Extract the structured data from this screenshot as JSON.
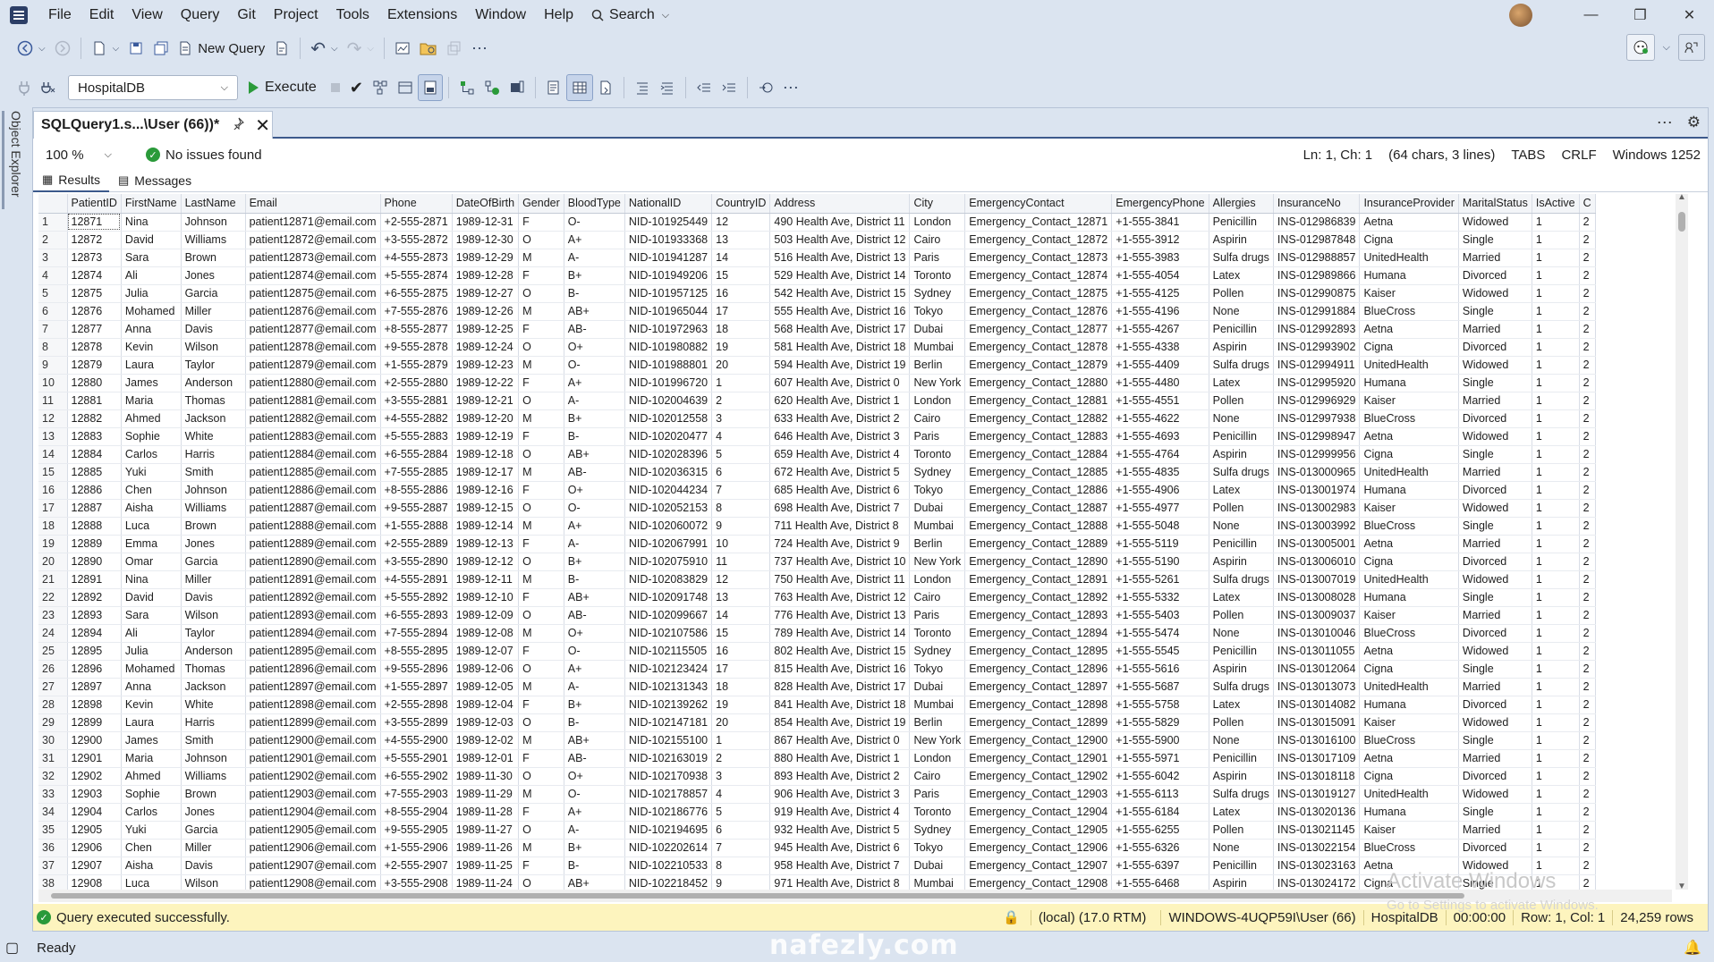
{
  "menu": [
    "File",
    "Edit",
    "View",
    "Query",
    "Git",
    "Project",
    "Tools",
    "Extensions",
    "Window",
    "Help"
  ],
  "search_label": "Search",
  "toolbar": {
    "new_query": "New Query",
    "execute": "Execute",
    "database": "HospitalDB"
  },
  "sidebar": {
    "object_explorer": "Object Explorer"
  },
  "tab": {
    "title": "SQLQuery1.s...\\User (66))*"
  },
  "editor": {
    "zoom": "100 %",
    "issues": "No issues found",
    "ln": "Ln: 1, Ch: 1",
    "chars": "(64 chars, 3 lines)",
    "tabs": "TABS",
    "crlf": "CRLF",
    "encoding": "Windows 1252"
  },
  "result_tabs": {
    "results": "Results",
    "messages": "Messages"
  },
  "grid": {
    "columns": [
      "PatientID",
      "FirstName",
      "LastName",
      "Email",
      "Phone",
      "DateOfBirth",
      "Gender",
      "BloodType",
      "NationalID",
      "CountryID",
      "Address",
      "City",
      "EmergencyContact",
      "EmergencyPhone",
      "Allergies",
      "InsuranceNo",
      "InsuranceProvider",
      "MaritalStatus",
      "IsActive",
      "C"
    ],
    "rows": [
      [
        "1",
        "12871",
        "Nina",
        "Johnson",
        "patient12871@email.com",
        "+2-555-2871",
        "1989-12-31",
        "F",
        "O-",
        "NID-101925449",
        "12",
        "490 Health Ave, District 11",
        "London",
        "Emergency_Contact_12871",
        "+1-555-3841",
        "Penicillin",
        "INS-012986839",
        "Aetna",
        "Widowed",
        "1",
        "2"
      ],
      [
        "2",
        "12872",
        "David",
        "Williams",
        "patient12872@email.com",
        "+3-555-2872",
        "1989-12-30",
        "O",
        "A+",
        "NID-101933368",
        "13",
        "503 Health Ave, District 12",
        "Cairo",
        "Emergency_Contact_12872",
        "+1-555-3912",
        "Aspirin",
        "INS-012987848",
        "Cigna",
        "Single",
        "1",
        "2"
      ],
      [
        "3",
        "12873",
        "Sara",
        "Brown",
        "patient12873@email.com",
        "+4-555-2873",
        "1989-12-29",
        "M",
        "A-",
        "NID-101941287",
        "14",
        "516 Health Ave, District 13",
        "Paris",
        "Emergency_Contact_12873",
        "+1-555-3983",
        "Sulfa drugs",
        "INS-012988857",
        "UnitedHealth",
        "Married",
        "1",
        "2"
      ],
      [
        "4",
        "12874",
        "Ali",
        "Jones",
        "patient12874@email.com",
        "+5-555-2874",
        "1989-12-28",
        "F",
        "B+",
        "NID-101949206",
        "15",
        "529 Health Ave, District 14",
        "Toronto",
        "Emergency_Contact_12874",
        "+1-555-4054",
        "Latex",
        "INS-012989866",
        "Humana",
        "Divorced",
        "1",
        "2"
      ],
      [
        "5",
        "12875",
        "Julia",
        "Garcia",
        "patient12875@email.com",
        "+6-555-2875",
        "1989-12-27",
        "O",
        "B-",
        "NID-101957125",
        "16",
        "542 Health Ave, District 15",
        "Sydney",
        "Emergency_Contact_12875",
        "+1-555-4125",
        "Pollen",
        "INS-012990875",
        "Kaiser",
        "Widowed",
        "1",
        "2"
      ],
      [
        "6",
        "12876",
        "Mohamed",
        "Miller",
        "patient12876@email.com",
        "+7-555-2876",
        "1989-12-26",
        "M",
        "AB+",
        "NID-101965044",
        "17",
        "555 Health Ave, District 16",
        "Tokyo",
        "Emergency_Contact_12876",
        "+1-555-4196",
        "None",
        "INS-012991884",
        "BlueCross",
        "Single",
        "1",
        "2"
      ],
      [
        "7",
        "12877",
        "Anna",
        "Davis",
        "patient12877@email.com",
        "+8-555-2877",
        "1989-12-25",
        "F",
        "AB-",
        "NID-101972963",
        "18",
        "568 Health Ave, District 17",
        "Dubai",
        "Emergency_Contact_12877",
        "+1-555-4267",
        "Penicillin",
        "INS-012992893",
        "Aetna",
        "Married",
        "1",
        "2"
      ],
      [
        "8",
        "12878",
        "Kevin",
        "Wilson",
        "patient12878@email.com",
        "+9-555-2878",
        "1989-12-24",
        "O",
        "O+",
        "NID-101980882",
        "19",
        "581 Health Ave, District 18",
        "Mumbai",
        "Emergency_Contact_12878",
        "+1-555-4338",
        "Aspirin",
        "INS-012993902",
        "Cigna",
        "Divorced",
        "1",
        "2"
      ],
      [
        "9",
        "12879",
        "Laura",
        "Taylor",
        "patient12879@email.com",
        "+1-555-2879",
        "1989-12-23",
        "M",
        "O-",
        "NID-101988801",
        "20",
        "594 Health Ave, District 19",
        "Berlin",
        "Emergency_Contact_12879",
        "+1-555-4409",
        "Sulfa drugs",
        "INS-012994911",
        "UnitedHealth",
        "Widowed",
        "1",
        "2"
      ],
      [
        "10",
        "12880",
        "James",
        "Anderson",
        "patient12880@email.com",
        "+2-555-2880",
        "1989-12-22",
        "F",
        "A+",
        "NID-101996720",
        "1",
        "607 Health Ave, District 0",
        "New York",
        "Emergency_Contact_12880",
        "+1-555-4480",
        "Latex",
        "INS-012995920",
        "Humana",
        "Single",
        "1",
        "2"
      ],
      [
        "11",
        "12881",
        "Maria",
        "Thomas",
        "patient12881@email.com",
        "+3-555-2881",
        "1989-12-21",
        "O",
        "A-",
        "NID-102004639",
        "2",
        "620 Health Ave, District 1",
        "London",
        "Emergency_Contact_12881",
        "+1-555-4551",
        "Pollen",
        "INS-012996929",
        "Kaiser",
        "Married",
        "1",
        "2"
      ],
      [
        "12",
        "12882",
        "Ahmed",
        "Jackson",
        "patient12882@email.com",
        "+4-555-2882",
        "1989-12-20",
        "M",
        "B+",
        "NID-102012558",
        "3",
        "633 Health Ave, District 2",
        "Cairo",
        "Emergency_Contact_12882",
        "+1-555-4622",
        "None",
        "INS-012997938",
        "BlueCross",
        "Divorced",
        "1",
        "2"
      ],
      [
        "13",
        "12883",
        "Sophie",
        "White",
        "patient12883@email.com",
        "+5-555-2883",
        "1989-12-19",
        "F",
        "B-",
        "NID-102020477",
        "4",
        "646 Health Ave, District 3",
        "Paris",
        "Emergency_Contact_12883",
        "+1-555-4693",
        "Penicillin",
        "INS-012998947",
        "Aetna",
        "Widowed",
        "1",
        "2"
      ],
      [
        "14",
        "12884",
        "Carlos",
        "Harris",
        "patient12884@email.com",
        "+6-555-2884",
        "1989-12-18",
        "O",
        "AB+",
        "NID-102028396",
        "5",
        "659 Health Ave, District 4",
        "Toronto",
        "Emergency_Contact_12884",
        "+1-555-4764",
        "Aspirin",
        "INS-012999956",
        "Cigna",
        "Single",
        "1",
        "2"
      ],
      [
        "15",
        "12885",
        "Yuki",
        "Smith",
        "patient12885@email.com",
        "+7-555-2885",
        "1989-12-17",
        "M",
        "AB-",
        "NID-102036315",
        "6",
        "672 Health Ave, District 5",
        "Sydney",
        "Emergency_Contact_12885",
        "+1-555-4835",
        "Sulfa drugs",
        "INS-013000965",
        "UnitedHealth",
        "Married",
        "1",
        "2"
      ],
      [
        "16",
        "12886",
        "Chen",
        "Johnson",
        "patient12886@email.com",
        "+8-555-2886",
        "1989-12-16",
        "F",
        "O+",
        "NID-102044234",
        "7",
        "685 Health Ave, District 6",
        "Tokyo",
        "Emergency_Contact_12886",
        "+1-555-4906",
        "Latex",
        "INS-013001974",
        "Humana",
        "Divorced",
        "1",
        "2"
      ],
      [
        "17",
        "12887",
        "Aisha",
        "Williams",
        "patient12887@email.com",
        "+9-555-2887",
        "1989-12-15",
        "O",
        "O-",
        "NID-102052153",
        "8",
        "698 Health Ave, District 7",
        "Dubai",
        "Emergency_Contact_12887",
        "+1-555-4977",
        "Pollen",
        "INS-013002983",
        "Kaiser",
        "Widowed",
        "1",
        "2"
      ],
      [
        "18",
        "12888",
        "Luca",
        "Brown",
        "patient12888@email.com",
        "+1-555-2888",
        "1989-12-14",
        "M",
        "A+",
        "NID-102060072",
        "9",
        "711 Health Ave, District 8",
        "Mumbai",
        "Emergency_Contact_12888",
        "+1-555-5048",
        "None",
        "INS-013003992",
        "BlueCross",
        "Single",
        "1",
        "2"
      ],
      [
        "19",
        "12889",
        "Emma",
        "Jones",
        "patient12889@email.com",
        "+2-555-2889",
        "1989-12-13",
        "F",
        "A-",
        "NID-102067991",
        "10",
        "724 Health Ave, District 9",
        "Berlin",
        "Emergency_Contact_12889",
        "+1-555-5119",
        "Penicillin",
        "INS-013005001",
        "Aetna",
        "Married",
        "1",
        "2"
      ],
      [
        "20",
        "12890",
        "Omar",
        "Garcia",
        "patient12890@email.com",
        "+3-555-2890",
        "1989-12-12",
        "O",
        "B+",
        "NID-102075910",
        "11",
        "737 Health Ave, District 10",
        "New York",
        "Emergency_Contact_12890",
        "+1-555-5190",
        "Aspirin",
        "INS-013006010",
        "Cigna",
        "Divorced",
        "1",
        "2"
      ],
      [
        "21",
        "12891",
        "Nina",
        "Miller",
        "patient12891@email.com",
        "+4-555-2891",
        "1989-12-11",
        "M",
        "B-",
        "NID-102083829",
        "12",
        "750 Health Ave, District 11",
        "London",
        "Emergency_Contact_12891",
        "+1-555-5261",
        "Sulfa drugs",
        "INS-013007019",
        "UnitedHealth",
        "Widowed",
        "1",
        "2"
      ],
      [
        "22",
        "12892",
        "David",
        "Davis",
        "patient12892@email.com",
        "+5-555-2892",
        "1989-12-10",
        "F",
        "AB+",
        "NID-102091748",
        "13",
        "763 Health Ave, District 12",
        "Cairo",
        "Emergency_Contact_12892",
        "+1-555-5332",
        "Latex",
        "INS-013008028",
        "Humana",
        "Single",
        "1",
        "2"
      ],
      [
        "23",
        "12893",
        "Sara",
        "Wilson",
        "patient12893@email.com",
        "+6-555-2893",
        "1989-12-09",
        "O",
        "AB-",
        "NID-102099667",
        "14",
        "776 Health Ave, District 13",
        "Paris",
        "Emergency_Contact_12893",
        "+1-555-5403",
        "Pollen",
        "INS-013009037",
        "Kaiser",
        "Married",
        "1",
        "2"
      ],
      [
        "24",
        "12894",
        "Ali",
        "Taylor",
        "patient12894@email.com",
        "+7-555-2894",
        "1989-12-08",
        "M",
        "O+",
        "NID-102107586",
        "15",
        "789 Health Ave, District 14",
        "Toronto",
        "Emergency_Contact_12894",
        "+1-555-5474",
        "None",
        "INS-013010046",
        "BlueCross",
        "Divorced",
        "1",
        "2"
      ],
      [
        "25",
        "12895",
        "Julia",
        "Anderson",
        "patient12895@email.com",
        "+8-555-2895",
        "1989-12-07",
        "F",
        "O-",
        "NID-102115505",
        "16",
        "802 Health Ave, District 15",
        "Sydney",
        "Emergency_Contact_12895",
        "+1-555-5545",
        "Penicillin",
        "INS-013011055",
        "Aetna",
        "Widowed",
        "1",
        "2"
      ],
      [
        "26",
        "12896",
        "Mohamed",
        "Thomas",
        "patient12896@email.com",
        "+9-555-2896",
        "1989-12-06",
        "O",
        "A+",
        "NID-102123424",
        "17",
        "815 Health Ave, District 16",
        "Tokyo",
        "Emergency_Contact_12896",
        "+1-555-5616",
        "Aspirin",
        "INS-013012064",
        "Cigna",
        "Single",
        "1",
        "2"
      ],
      [
        "27",
        "12897",
        "Anna",
        "Jackson",
        "patient12897@email.com",
        "+1-555-2897",
        "1989-12-05",
        "M",
        "A-",
        "NID-102131343",
        "18",
        "828 Health Ave, District 17",
        "Dubai",
        "Emergency_Contact_12897",
        "+1-555-5687",
        "Sulfa drugs",
        "INS-013013073",
        "UnitedHealth",
        "Married",
        "1",
        "2"
      ],
      [
        "28",
        "12898",
        "Kevin",
        "White",
        "patient12898@email.com",
        "+2-555-2898",
        "1989-12-04",
        "F",
        "B+",
        "NID-102139262",
        "19",
        "841 Health Ave, District 18",
        "Mumbai",
        "Emergency_Contact_12898",
        "+1-555-5758",
        "Latex",
        "INS-013014082",
        "Humana",
        "Divorced",
        "1",
        "2"
      ],
      [
        "29",
        "12899",
        "Laura",
        "Harris",
        "patient12899@email.com",
        "+3-555-2899",
        "1989-12-03",
        "O",
        "B-",
        "NID-102147181",
        "20",
        "854 Health Ave, District 19",
        "Berlin",
        "Emergency_Contact_12899",
        "+1-555-5829",
        "Pollen",
        "INS-013015091",
        "Kaiser",
        "Widowed",
        "1",
        "2"
      ],
      [
        "30",
        "12900",
        "James",
        "Smith",
        "patient12900@email.com",
        "+4-555-2900",
        "1989-12-02",
        "M",
        "AB+",
        "NID-102155100",
        "1",
        "867 Health Ave, District 0",
        "New York",
        "Emergency_Contact_12900",
        "+1-555-5900",
        "None",
        "INS-013016100",
        "BlueCross",
        "Single",
        "1",
        "2"
      ],
      [
        "31",
        "12901",
        "Maria",
        "Johnson",
        "patient12901@email.com",
        "+5-555-2901",
        "1989-12-01",
        "F",
        "AB-",
        "NID-102163019",
        "2",
        "880 Health Ave, District 1",
        "London",
        "Emergency_Contact_12901",
        "+1-555-5971",
        "Penicillin",
        "INS-013017109",
        "Aetna",
        "Married",
        "1",
        "2"
      ],
      [
        "32",
        "12902",
        "Ahmed",
        "Williams",
        "patient12902@email.com",
        "+6-555-2902",
        "1989-11-30",
        "O",
        "O+",
        "NID-102170938",
        "3",
        "893 Health Ave, District 2",
        "Cairo",
        "Emergency_Contact_12902",
        "+1-555-6042",
        "Aspirin",
        "INS-013018118",
        "Cigna",
        "Divorced",
        "1",
        "2"
      ],
      [
        "33",
        "12903",
        "Sophie",
        "Brown",
        "patient12903@email.com",
        "+7-555-2903",
        "1989-11-29",
        "M",
        "O-",
        "NID-102178857",
        "4",
        "906 Health Ave, District 3",
        "Paris",
        "Emergency_Contact_12903",
        "+1-555-6113",
        "Sulfa drugs",
        "INS-013019127",
        "UnitedHealth",
        "Widowed",
        "1",
        "2"
      ],
      [
        "34",
        "12904",
        "Carlos",
        "Jones",
        "patient12904@email.com",
        "+8-555-2904",
        "1989-11-28",
        "F",
        "A+",
        "NID-102186776",
        "5",
        "919 Health Ave, District 4",
        "Toronto",
        "Emergency_Contact_12904",
        "+1-555-6184",
        "Latex",
        "INS-013020136",
        "Humana",
        "Single",
        "1",
        "2"
      ],
      [
        "35",
        "12905",
        "Yuki",
        "Garcia",
        "patient12905@email.com",
        "+9-555-2905",
        "1989-11-27",
        "O",
        "A-",
        "NID-102194695",
        "6",
        "932 Health Ave, District 5",
        "Sydney",
        "Emergency_Contact_12905",
        "+1-555-6255",
        "Pollen",
        "INS-013021145",
        "Kaiser",
        "Married",
        "1",
        "2"
      ],
      [
        "36",
        "12906",
        "Chen",
        "Miller",
        "patient12906@email.com",
        "+1-555-2906",
        "1989-11-26",
        "M",
        "B+",
        "NID-102202614",
        "7",
        "945 Health Ave, District 6",
        "Tokyo",
        "Emergency_Contact_12906",
        "+1-555-6326",
        "None",
        "INS-013022154",
        "BlueCross",
        "Divorced",
        "1",
        "2"
      ],
      [
        "37",
        "12907",
        "Aisha",
        "Davis",
        "patient12907@email.com",
        "+2-555-2907",
        "1989-11-25",
        "F",
        "B-",
        "NID-102210533",
        "8",
        "958 Health Ave, District 7",
        "Dubai",
        "Emergency_Contact_12907",
        "+1-555-6397",
        "Penicillin",
        "INS-013023163",
        "Aetna",
        "Widowed",
        "1",
        "2"
      ],
      [
        "38",
        "12908",
        "Luca",
        "Wilson",
        "patient12908@email.com",
        "+3-555-2908",
        "1989-11-24",
        "O",
        "AB+",
        "NID-102218452",
        "9",
        "971 Health Ave, District 8",
        "Mumbai",
        "Emergency_Contact_12908",
        "+1-555-6468",
        "Aspirin",
        "INS-013024172",
        "Cigna",
        "Single",
        "1",
        "2"
      ]
    ]
  },
  "query_status": {
    "message": "Query executed successfully.",
    "server": "(local) (17.0 RTM)",
    "user": "WINDOWS-4UQP59I\\User (66)",
    "db": "HospitalDB",
    "time": "00:00:00",
    "pos": "Row: 1, Col: 1",
    "rows": "24,259 rows"
  },
  "bottom": {
    "status": "Ready"
  },
  "overlay": {
    "watermark": "nafezly.com",
    "activate": "Activate Windows",
    "activate_sub": "Go to Settings to activate Windows."
  }
}
